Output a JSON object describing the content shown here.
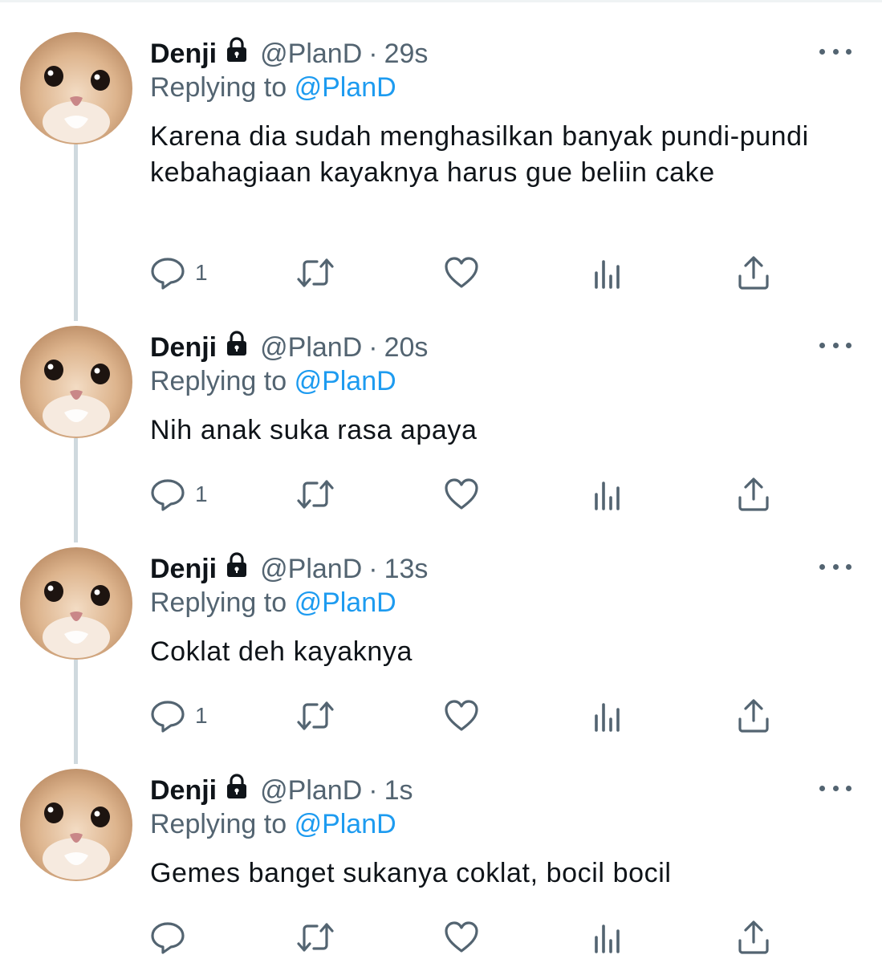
{
  "colors": {
    "text_primary": "#0f1419",
    "text_secondary": "#536471",
    "link": "#1d9bf0",
    "thread_line": "#cfd9de"
  },
  "tweets": [
    {
      "name": "Denji",
      "handle": "@PlanD",
      "separator": "·",
      "time": "29s",
      "replying_label": "Replying to",
      "replying_to": "@PlanD",
      "text": "Karena dia sudah menghasilkan banyak pundi-pundi kebahagiaan kayaknya harus gue beliin cake",
      "reply_count": "1"
    },
    {
      "name": "Denji",
      "handle": "@PlanD",
      "separator": "·",
      "time": "20s",
      "replying_label": "Replying to",
      "replying_to": "@PlanD",
      "text": "Nih anak suka rasa apaya",
      "reply_count": "1"
    },
    {
      "name": "Denji",
      "handle": "@PlanD",
      "separator": "·",
      "time": "13s",
      "replying_label": "Replying to",
      "replying_to": "@PlanD",
      "text": "Coklat deh kayaknya",
      "reply_count": "1"
    },
    {
      "name": "Denji",
      "handle": "@PlanD",
      "separator": "·",
      "time": "1s",
      "replying_label": "Replying to",
      "replying_to": "@PlanD",
      "text": "Gemes banget sukanya coklat, bocil bocil",
      "reply_count": ""
    }
  ],
  "icons": {
    "avatar": "cat-face-avatar",
    "lock": "lock-icon",
    "more": "more-options-icon",
    "reply": "reply-icon",
    "retweet": "retweet-icon",
    "like": "heart-icon",
    "analytics": "analytics-icon",
    "share": "share-icon"
  }
}
